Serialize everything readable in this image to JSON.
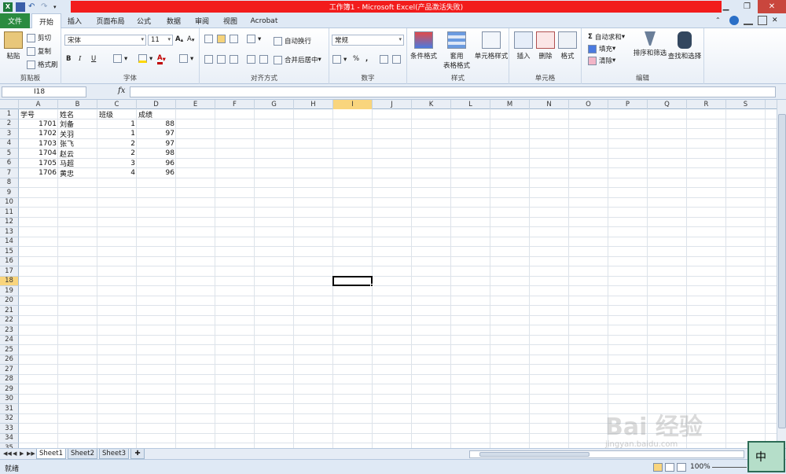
{
  "window": {
    "title": "工作簿1 - Microsoft Excel(产品激活失败)",
    "colors": {
      "title_bar": "#f21c1c",
      "file_tab": "#2a8b3f",
      "selected_header": "#f9d57d"
    }
  },
  "tabs": [
    {
      "label": "文件"
    },
    {
      "label": "开始"
    },
    {
      "label": "插入"
    },
    {
      "label": "页面布局"
    },
    {
      "label": "公式"
    },
    {
      "label": "数据"
    },
    {
      "label": "审阅"
    },
    {
      "label": "视图"
    },
    {
      "label": "Acrobat"
    }
  ],
  "ribbon": {
    "clipboard": {
      "label": "剪贴板",
      "paste": "粘贴",
      "cut": "剪切",
      "copy": "复制",
      "format_painter": "格式刷"
    },
    "font": {
      "label": "字体",
      "font_name": "宋体",
      "font_size": "11",
      "bold": "B",
      "italic": "I",
      "underline": "U"
    },
    "alignment": {
      "label": "对齐方式",
      "wrap": "自动换行",
      "merge": "合并后居中"
    },
    "number": {
      "label": "数字",
      "format": "常规",
      "percent": "%",
      "comma": ","
    },
    "styles": {
      "label": "样式",
      "conditional": "条件格式",
      "table_line1": "套用",
      "table_line2": "表格格式",
      "cell_styles": "单元格样式"
    },
    "cells": {
      "label": "单元格",
      "insert": "插入",
      "delete": "删除",
      "format": "格式"
    },
    "editing": {
      "label": "编辑",
      "autosum": "自动求和",
      "fill": "填充",
      "clear": "清除",
      "sort": "排序和筛选",
      "find": "查找和选择"
    }
  },
  "formula_bar": {
    "name_box": "I18",
    "fx": "fx",
    "content": ""
  },
  "grid": {
    "columns": [
      "A",
      "B",
      "C",
      "D",
      "E",
      "F",
      "G",
      "H",
      "I",
      "J",
      "K",
      "L",
      "M",
      "N",
      "O",
      "P",
      "Q",
      "R",
      "S"
    ],
    "rows": [
      "1",
      "2",
      "3",
      "4",
      "5",
      "6",
      "7",
      "8",
      "9",
      "10",
      "11",
      "12",
      "13",
      "14",
      "15",
      "16",
      "17",
      "18",
      "19",
      "20",
      "21",
      "22",
      "23",
      "24",
      "25",
      "26",
      "27",
      "28",
      "29",
      "30",
      "31",
      "32",
      "33",
      "34",
      "35"
    ],
    "selected_cell": "I18",
    "data": [
      [
        "学号",
        "姓名",
        "班级",
        "成绩"
      ],
      [
        "1701",
        "刘备",
        "1",
        "88"
      ],
      [
        "1702",
        "关羽",
        "1",
        "97"
      ],
      [
        "1703",
        "张飞",
        "2",
        "97"
      ],
      [
        "1704",
        "赵云",
        "2",
        "98"
      ],
      [
        "1705",
        "马超",
        "3",
        "96"
      ],
      [
        "1706",
        "黄忠",
        "4",
        "96"
      ]
    ]
  },
  "sheets": [
    "Sheet1",
    "Sheet2",
    "Sheet3"
  ],
  "status": {
    "ready": "就绪",
    "zoom": "100%"
  },
  "ime": {
    "label": "中"
  },
  "watermark": {
    "text": "Bai 经验",
    "url": "jingyan.baidu.com"
  }
}
